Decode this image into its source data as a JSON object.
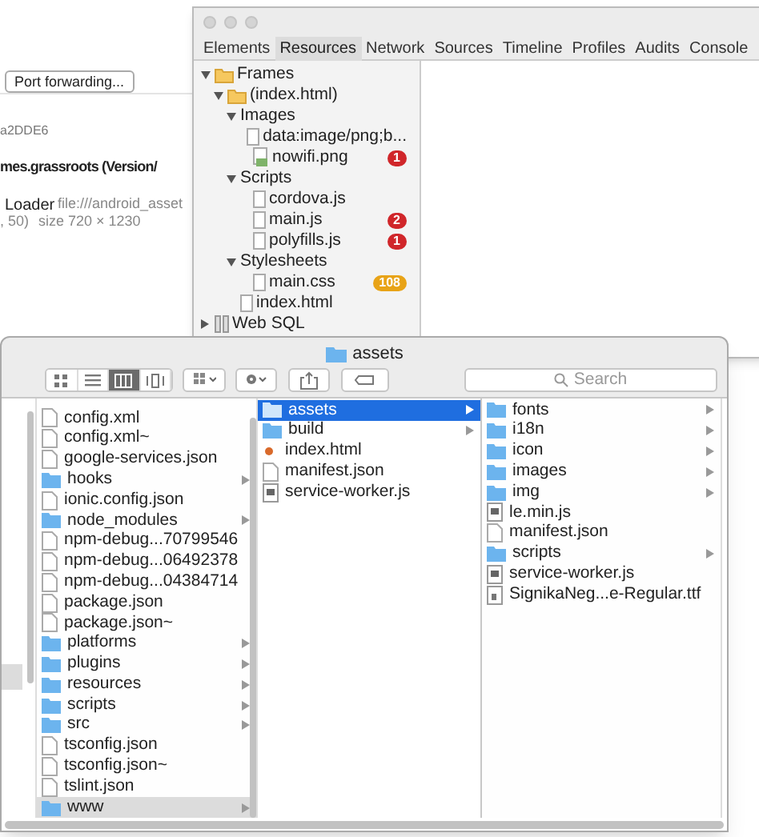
{
  "background_page": {
    "port_button": "Port forwarding...",
    "device_id": "a2DDE6",
    "app_title": "mes.grassroots (Version/",
    "loader_label": "Loader",
    "loader_url": "file:///android_asset",
    "position": ", 50)",
    "size": "size 720 × 1230"
  },
  "devtools": {
    "tabs": [
      {
        "label": "Elements",
        "selected": false
      },
      {
        "label": "Resources",
        "selected": true
      },
      {
        "label": "Network",
        "selected": false
      },
      {
        "label": "Sources",
        "selected": false
      },
      {
        "label": "Timeline",
        "selected": false
      },
      {
        "label": "Profiles",
        "selected": false
      },
      {
        "label": "Audits",
        "selected": false
      },
      {
        "label": "Console",
        "selected": false
      }
    ],
    "tree": [
      {
        "label": "Frames",
        "kind": "folder",
        "expanded": true,
        "children": [
          {
            "label": "(index.html)",
            "kind": "folder",
            "expanded": true,
            "children": [
              {
                "label": "Images",
                "kind": "group",
                "expanded": true,
                "children": [
                  {
                    "label": "data:image/png;b...",
                    "kind": "file"
                  },
                  {
                    "label": "nowifi.png",
                    "kind": "broken-image",
                    "badge": "1",
                    "color": "#d0262a"
                  }
                ]
              },
              {
                "label": "Scripts",
                "kind": "group",
                "expanded": true,
                "children": [
                  {
                    "label": "cordova.js",
                    "kind": "file"
                  },
                  {
                    "label": "main.js",
                    "kind": "file",
                    "badge": "2",
                    "color": "#d0262a"
                  },
                  {
                    "label": "polyfills.js",
                    "kind": "file",
                    "badge": "1",
                    "color": "#d0262a"
                  }
                ]
              },
              {
                "label": "Stylesheets",
                "kind": "group",
                "expanded": true,
                "children": [
                  {
                    "label": "main.css",
                    "kind": "file",
                    "badge": "108",
                    "color": "#e8a317"
                  }
                ]
              },
              {
                "label": "index.html",
                "kind": "file"
              }
            ]
          }
        ]
      },
      {
        "label": "Web SQL",
        "kind": "database",
        "expanded": false
      }
    ]
  },
  "finder": {
    "title": "assets",
    "view_modes": [
      {
        "kind": "icons",
        "selected": false
      },
      {
        "kind": "list",
        "selected": false
      },
      {
        "kind": "columns",
        "selected": true
      },
      {
        "kind": "cover-flow",
        "selected": false
      }
    ],
    "toolbar": [
      {
        "kind": "arrange"
      },
      {
        "kind": "action"
      },
      {
        "kind": "share"
      },
      {
        "kind": "tag"
      }
    ],
    "search": {
      "placeholder": "Search"
    },
    "columns": [
      {
        "active": false,
        "items": [
          {
            "name": "config.xml",
            "kind": "file",
            "selected": false
          },
          {
            "name": "config.xml~",
            "kind": "file",
            "selected": false
          },
          {
            "name": "google-services.json",
            "kind": "file",
            "selected": false
          },
          {
            "name": "hooks",
            "kind": "folder",
            "selected": false
          },
          {
            "name": "ionic.config.json",
            "kind": "file",
            "selected": false
          },
          {
            "name": "node_modules",
            "kind": "folder",
            "selected": false
          },
          {
            "name": "npm-debug...70799546",
            "kind": "file",
            "selected": false
          },
          {
            "name": "npm-debug...06492378",
            "kind": "file",
            "selected": false
          },
          {
            "name": "npm-debug...04384714",
            "kind": "file",
            "selected": false
          },
          {
            "name": "package.json",
            "kind": "file",
            "selected": false
          },
          {
            "name": "package.json~",
            "kind": "file",
            "selected": false
          },
          {
            "name": "platforms",
            "kind": "folder",
            "selected": false
          },
          {
            "name": "plugins",
            "kind": "folder",
            "selected": false
          },
          {
            "name": "resources",
            "kind": "folder",
            "selected": false
          },
          {
            "name": "scripts",
            "kind": "folder",
            "selected": false
          },
          {
            "name": "src",
            "kind": "folder",
            "selected": false
          },
          {
            "name": "tsconfig.json",
            "kind": "file",
            "selected": false
          },
          {
            "name": "tsconfig.json~",
            "kind": "file",
            "selected": false
          },
          {
            "name": "tslint.json",
            "kind": "file",
            "selected": false
          },
          {
            "name": "www",
            "kind": "folder",
            "selected": true
          }
        ]
      },
      {
        "active": true,
        "items": [
          {
            "name": "assets",
            "kind": "folder",
            "selected": true
          },
          {
            "name": "build",
            "kind": "folder",
            "selected": false
          },
          {
            "name": "index.html",
            "kind": "html",
            "selected": false
          },
          {
            "name": "manifest.json",
            "kind": "file",
            "selected": false
          },
          {
            "name": "service-worker.js",
            "kind": "script",
            "selected": false
          }
        ]
      },
      {
        "active": false,
        "items": [
          {
            "name": "fonts",
            "kind": "folder",
            "selected": false
          },
          {
            "name": "i18n",
            "kind": "folder",
            "selected": false
          },
          {
            "name": "icon",
            "kind": "folder",
            "selected": false
          },
          {
            "name": "images",
            "kind": "folder",
            "selected": false
          },
          {
            "name": "img",
            "kind": "folder",
            "selected": false
          },
          {
            "name": "le.min.js",
            "kind": "script",
            "selected": false
          },
          {
            "name": "manifest.json",
            "kind": "file",
            "selected": false
          },
          {
            "name": "scripts",
            "kind": "folder",
            "selected": false
          },
          {
            "name": "service-worker.js",
            "kind": "script",
            "selected": false
          },
          {
            "name": "SignikaNeg...e-Regular.ttf",
            "kind": "font",
            "selected": false
          }
        ]
      }
    ]
  }
}
